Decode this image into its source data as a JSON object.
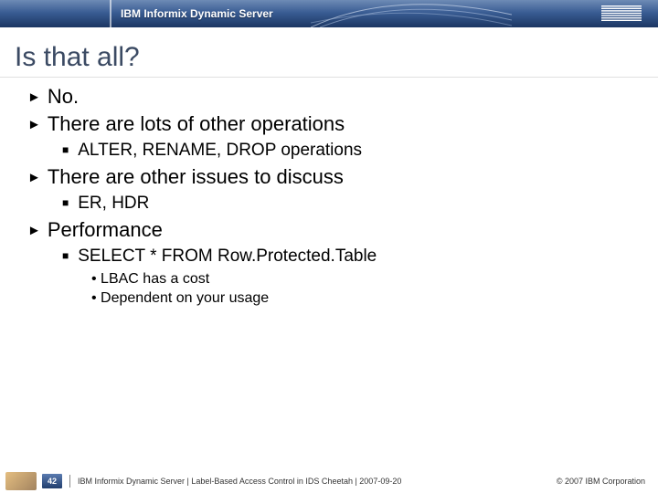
{
  "header": {
    "product": "IBM Informix Dynamic Server",
    "logo_label": "IBM"
  },
  "slide": {
    "title": "Is that all?"
  },
  "content": {
    "p1": "No.",
    "p2": "There are lots of other operations",
    "p2a": "ALTER, RENAME, DROP operations",
    "p3": "There are other issues to discuss",
    "p3a": "ER, HDR",
    "p4": "Performance",
    "p4a": "SELECT * FROM Row.Protected.Table",
    "p4a1": "LBAC has a cost",
    "p4a2": "Dependent on your usage"
  },
  "footer": {
    "page_number": "42",
    "text": "IBM Informix Dynamic Server | Label-Based Access Control in IDS Cheetah | 2007-09-20",
    "copyright": "© 2007 IBM Corporation"
  }
}
